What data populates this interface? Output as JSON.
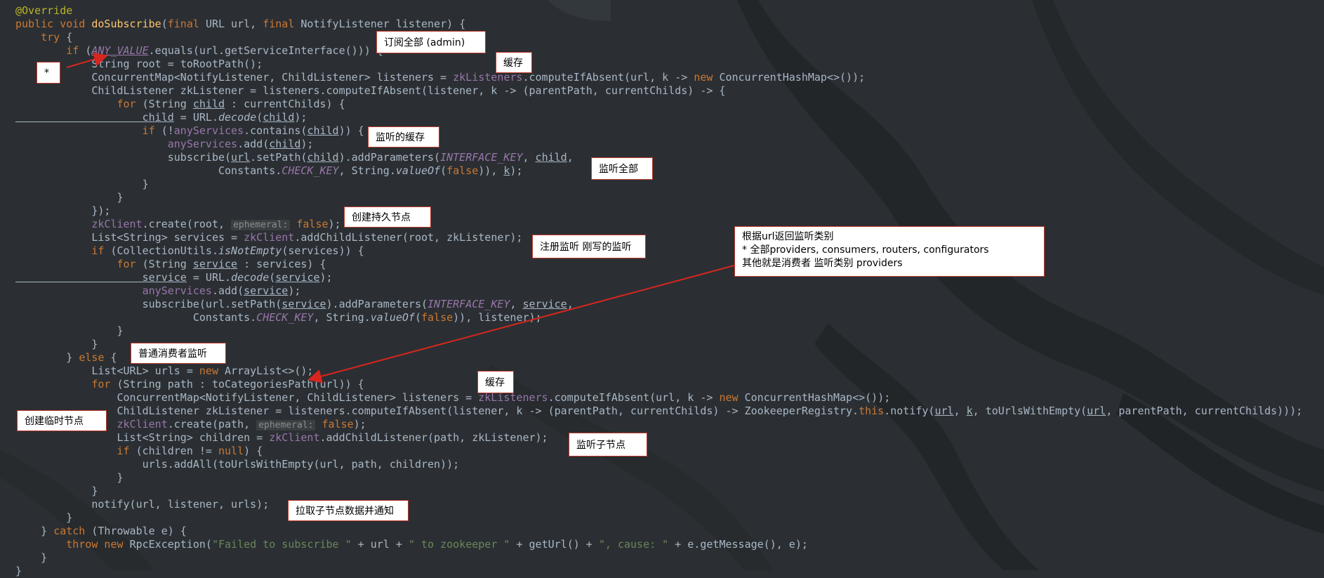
{
  "editor": {
    "lines": [
      [
        {
          "c": "t-ann",
          "t": "@Override"
        }
      ],
      [
        {
          "c": "t-kw",
          "t": "public void "
        },
        {
          "c": "t-fn",
          "t": "doSubscribe"
        },
        {
          "c": "t-pl",
          "t": "("
        },
        {
          "c": "t-kw",
          "t": "final "
        },
        {
          "c": "t-pl",
          "t": "URL url, "
        },
        {
          "c": "t-kw",
          "t": "final "
        },
        {
          "c": "t-pl",
          "t": "NotifyListener listener) {"
        }
      ],
      [
        {
          "c": "t-kw",
          "t": "    try "
        },
        {
          "c": "t-pl",
          "t": "{"
        }
      ],
      [
        {
          "c": "t-kw",
          "t": "        if "
        },
        {
          "c": "t-pl",
          "t": "("
        },
        {
          "c": "t-cst t-ul",
          "t": "ANY_VALUE"
        },
        {
          "c": "t-pl",
          "t": ".equals(url.getServiceInterface())) {"
        }
      ],
      [
        {
          "c": "t-pl",
          "t": "            String root = toRootPath();"
        }
      ],
      [
        {
          "c": "t-pl",
          "t": "            ConcurrentMap<NotifyListener, ChildListener> listeners = "
        },
        {
          "c": "t-fld",
          "t": "zkListeners"
        },
        {
          "c": "t-pl",
          "t": ".computeIfAbsent(url, k -> "
        },
        {
          "c": "t-kw",
          "t": "new "
        },
        {
          "c": "t-pl",
          "t": "ConcurrentHashMap<>());"
        }
      ],
      [
        {
          "c": "t-pl",
          "t": "            ChildListener zkListener = listeners.computeIfAbsent(listener, k -> (parentPath, currentChilds) -> {"
        }
      ],
      [
        {
          "c": "t-kw",
          "t": "                for "
        },
        {
          "c": "t-pl",
          "t": "(String "
        },
        {
          "c": "t-ul",
          "t": "child"
        },
        {
          "c": "t-pl",
          "t": " : currentChilds) {"
        }
      ],
      [
        {
          "c": "t-ul",
          "t": "                    child"
        },
        {
          "c": "t-pl",
          "t": " = URL."
        },
        {
          "c": "t-ita",
          "t": "decode"
        },
        {
          "c": "t-pl",
          "t": "("
        },
        {
          "c": "t-ul",
          "t": "child"
        },
        {
          "c": "t-pl",
          "t": ");"
        }
      ],
      [
        {
          "c": "t-kw",
          "t": "                    if "
        },
        {
          "c": "t-pl",
          "t": "(!"
        },
        {
          "c": "t-fld",
          "t": "anyServices"
        },
        {
          "c": "t-pl",
          "t": ".contains("
        },
        {
          "c": "t-ul",
          "t": "child"
        },
        {
          "c": "t-pl",
          "t": ")) {"
        }
      ],
      [
        {
          "c": "t-fld",
          "t": "                        anyServices"
        },
        {
          "c": "t-pl",
          "t": ".add("
        },
        {
          "c": "t-ul",
          "t": "child"
        },
        {
          "c": "t-pl",
          "t": ");"
        }
      ],
      [
        {
          "c": "t-pl",
          "t": "                        subscribe("
        },
        {
          "c": "t-ul",
          "t": "url"
        },
        {
          "c": "t-pl",
          "t": ".setPath("
        },
        {
          "c": "t-ul",
          "t": "child"
        },
        {
          "c": "t-pl",
          "t": ").addParameters("
        },
        {
          "c": "t-cst",
          "t": "INTERFACE_KEY"
        },
        {
          "c": "t-pl",
          "t": ", "
        },
        {
          "c": "t-ul",
          "t": "child"
        },
        {
          "c": "t-pl",
          "t": ","
        }
      ],
      [
        {
          "c": "t-pl",
          "t": "                                Constants."
        },
        {
          "c": "t-cst",
          "t": "CHECK_KEY"
        },
        {
          "c": "t-pl",
          "t": ", String."
        },
        {
          "c": "t-ita",
          "t": "valueOf"
        },
        {
          "c": "t-pl",
          "t": "("
        },
        {
          "c": "t-kw",
          "t": "false"
        },
        {
          "c": "t-pl",
          "t": ")), "
        },
        {
          "c": "t-ul",
          "t": "k"
        },
        {
          "c": "t-pl",
          "t": ");"
        }
      ],
      [
        {
          "c": "t-pl",
          "t": "                    }"
        }
      ],
      [
        {
          "c": "t-pl",
          "t": "                }"
        }
      ],
      [
        {
          "c": "t-pl",
          "t": "            });"
        }
      ],
      [
        {
          "c": "t-fld",
          "t": "            zkClient"
        },
        {
          "c": "t-pl",
          "t": ".create(root, "
        },
        {
          "c": "t-hint",
          "t": "ephemeral:"
        },
        {
          "c": "t-kw",
          "t": " false"
        },
        {
          "c": "t-pl",
          "t": ");"
        }
      ],
      [
        {
          "c": "t-pl",
          "t": "            List<String> services = "
        },
        {
          "c": "t-fld",
          "t": "zkClient"
        },
        {
          "c": "t-pl",
          "t": ".addChildListener(root, zkListener);"
        }
      ],
      [
        {
          "c": "t-kw",
          "t": "            if "
        },
        {
          "c": "t-pl",
          "t": "(CollectionUtils."
        },
        {
          "c": "t-ita",
          "t": "isNotEmpty"
        },
        {
          "c": "t-pl",
          "t": "(services)) {"
        }
      ],
      [
        {
          "c": "t-kw",
          "t": "                for "
        },
        {
          "c": "t-pl",
          "t": "(String "
        },
        {
          "c": "t-ul",
          "t": "service"
        },
        {
          "c": "t-pl",
          "t": " : services) {"
        }
      ],
      [
        {
          "c": "t-ul",
          "t": "                    service"
        },
        {
          "c": "t-pl",
          "t": " = URL."
        },
        {
          "c": "t-ita",
          "t": "decode"
        },
        {
          "c": "t-pl",
          "t": "("
        },
        {
          "c": "t-ul",
          "t": "service"
        },
        {
          "c": "t-pl",
          "t": ");"
        }
      ],
      [
        {
          "c": "t-fld",
          "t": "                    anyServices"
        },
        {
          "c": "t-pl",
          "t": ".add("
        },
        {
          "c": "t-ul",
          "t": "service"
        },
        {
          "c": "t-pl",
          "t": ");"
        }
      ],
      [
        {
          "c": "t-pl",
          "t": "                    subscribe(url.setPath("
        },
        {
          "c": "t-ul",
          "t": "service"
        },
        {
          "c": "t-pl",
          "t": ").addParameters("
        },
        {
          "c": "t-cst",
          "t": "INTERFACE_KEY"
        },
        {
          "c": "t-pl",
          "t": ", "
        },
        {
          "c": "t-ul",
          "t": "service"
        },
        {
          "c": "t-pl",
          "t": ","
        }
      ],
      [
        {
          "c": "t-pl",
          "t": "                            Constants."
        },
        {
          "c": "t-cst",
          "t": "CHECK_KEY"
        },
        {
          "c": "t-pl",
          "t": ", String."
        },
        {
          "c": "t-ita",
          "t": "valueOf"
        },
        {
          "c": "t-pl",
          "t": "("
        },
        {
          "c": "t-kw",
          "t": "false"
        },
        {
          "c": "t-pl",
          "t": ")), listener);"
        }
      ],
      [
        {
          "c": "t-pl",
          "t": "                }"
        }
      ],
      [
        {
          "c": "t-pl",
          "t": "            }"
        }
      ],
      [
        {
          "c": "t-pl",
          "t": "        } "
        },
        {
          "c": "t-kw",
          "t": "else "
        },
        {
          "c": "t-pl",
          "t": "{"
        }
      ],
      [
        {
          "c": "t-pl",
          "t": "            List<URL> urls = "
        },
        {
          "c": "t-kw",
          "t": "new "
        },
        {
          "c": "t-pl",
          "t": "ArrayList<>();"
        }
      ],
      [
        {
          "c": "t-kw",
          "t": "            for "
        },
        {
          "c": "t-pl",
          "t": "(String path : toCategoriesPath(url)) {"
        }
      ],
      [
        {
          "c": "t-pl",
          "t": "                ConcurrentMap<NotifyListener, ChildListener> listeners = "
        },
        {
          "c": "t-fld",
          "t": "zkListeners"
        },
        {
          "c": "t-pl",
          "t": ".computeIfAbsent(url, k -> "
        },
        {
          "c": "t-kw",
          "t": "new "
        },
        {
          "c": "t-pl",
          "t": "ConcurrentHashMap<>());"
        }
      ],
      [
        {
          "c": "t-pl",
          "t": "                ChildListener zkListener = listeners.computeIfAbsent(listener, k -> (parentPath, currentChilds) -> ZookeeperRegistry."
        },
        {
          "c": "t-kw",
          "t": "this"
        },
        {
          "c": "t-pl",
          "t": ".notify("
        },
        {
          "c": "t-ul",
          "t": "url"
        },
        {
          "c": "t-pl",
          "t": ", "
        },
        {
          "c": "t-ul",
          "t": "k"
        },
        {
          "c": "t-pl",
          "t": ", toUrlsWithEmpty("
        },
        {
          "c": "t-ul",
          "t": "url"
        },
        {
          "c": "t-pl",
          "t": ", parentPath, currentChilds)));"
        }
      ],
      [
        {
          "c": "t-fld",
          "t": "                zkClient"
        },
        {
          "c": "t-pl",
          "t": ".create(path, "
        },
        {
          "c": "t-hint",
          "t": "ephemeral:"
        },
        {
          "c": "t-kw",
          "t": " false"
        },
        {
          "c": "t-pl",
          "t": ");"
        }
      ],
      [
        {
          "c": "t-pl",
          "t": "                List<String> children = "
        },
        {
          "c": "t-fld",
          "t": "zkClient"
        },
        {
          "c": "t-pl",
          "t": ".addChildListener(path, zkListener);"
        }
      ],
      [
        {
          "c": "t-kw",
          "t": "                if "
        },
        {
          "c": "t-pl",
          "t": "(children != "
        },
        {
          "c": "t-kw",
          "t": "null"
        },
        {
          "c": "t-pl",
          "t": ") {"
        }
      ],
      [
        {
          "c": "t-pl",
          "t": "                    urls.addAll(toUrlsWithEmpty(url, path, children));"
        }
      ],
      [
        {
          "c": "t-pl",
          "t": "                }"
        }
      ],
      [
        {
          "c": "t-pl",
          "t": "            }"
        }
      ],
      [
        {
          "c": "t-pl",
          "t": "            notify(url, listener, urls);"
        }
      ],
      [
        {
          "c": "t-pl",
          "t": "        }"
        }
      ],
      [
        {
          "c": "t-pl",
          "t": "    } "
        },
        {
          "c": "t-kw",
          "t": "catch "
        },
        {
          "c": "t-pl",
          "t": "(Throwable e) {"
        }
      ],
      [
        {
          "c": "t-kw",
          "t": "        throw new "
        },
        {
          "c": "t-pl",
          "t": "RpcException("
        },
        {
          "c": "t-str",
          "t": "\"Failed to subscribe \""
        },
        {
          "c": "t-pl",
          "t": " + url + "
        },
        {
          "c": "t-str",
          "t": "\" to zookeeper \""
        },
        {
          "c": "t-pl",
          "t": " + getUrl() + "
        },
        {
          "c": "t-str",
          "t": "\", cause: \""
        },
        {
          "c": "t-pl",
          "t": " + e.getMessage(), e);"
        }
      ],
      [
        {
          "c": "t-pl",
          "t": "    }"
        }
      ],
      [
        {
          "c": "t-pl",
          "t": "}"
        }
      ]
    ]
  },
  "callouts": {
    "subscribe_all": "订阅全部  (admin)",
    "star": "*",
    "cache_1": "缓存",
    "listener_cache": "监听的缓存",
    "listen_all": "监听全部",
    "create_persistent": "创建持久节点",
    "register_listener": "注册监听 刚写的监听",
    "category_line1": "根据url返回监听类别",
    "category_line2": "* 全部providers, consumers, routers, configurators",
    "category_line3": "其他就是消费者 监听类别 providers",
    "normal_consumer": "普通消费者监听",
    "cache_2": "缓存",
    "create_ephemeral": "创建临时节点",
    "listen_children": "监听子节点",
    "pull_notify": "拉取子节点数据并通知"
  },
  "colors": {
    "background": "#2b2f33",
    "callout_border": "#c0392b",
    "arrow": "#d7261e"
  }
}
